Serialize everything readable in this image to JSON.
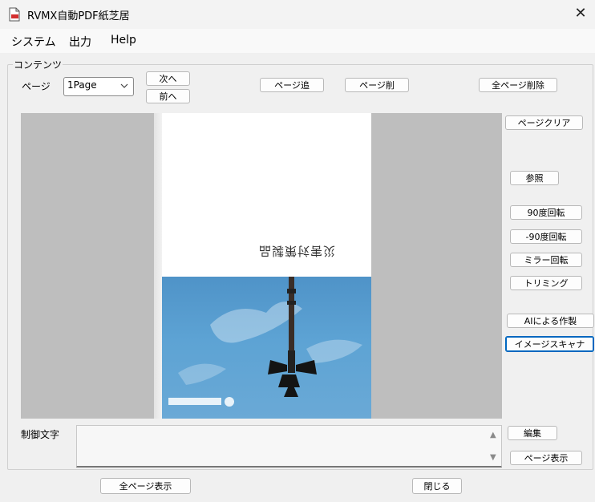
{
  "window": {
    "title": "RVMX自動PDF紙芝居",
    "close_glyph": "✕"
  },
  "menu": {
    "items": [
      "システム",
      "出力",
      "Help"
    ]
  },
  "contents": {
    "group_label": "コンテンツ",
    "page_label": "ページ",
    "page_select": {
      "value": "1Page"
    },
    "next_label": "次へ",
    "prev_label": "前へ",
    "page_add_label": "ページ追",
    "page_delete_label": "ページ削",
    "delete_all_label": "全ページ削除"
  },
  "side_buttons": {
    "page_clear": "ページクリア",
    "browse": "参照",
    "rotate_90": "90度回転",
    "rotate_minus_90": "-90度回転",
    "mirror_rotate": "ミラー回転",
    "trimming": "トリミング",
    "ai_create": "AIによる作製",
    "image_scanner": "イメージスキャナ"
  },
  "preview": {
    "page_title": "災害対策製品"
  },
  "control_text": {
    "label": "制御文字",
    "value": "",
    "edit_label": "編集",
    "page_display_label": "ページ表示"
  },
  "footer": {
    "show_all_label": "全ページ表示",
    "close_label": "閉じる"
  },
  "colors": {
    "viewer_bg": "#bebebe",
    "sky": "#5da3d4",
    "focus_border": "#0067c0"
  },
  "icons": {
    "app": "pdf-document-icon",
    "close": "close-icon",
    "dropdown": "chevron-down-icon",
    "scroll_up": "scroll-up-arrow-icon",
    "scroll_down": "scroll-down-arrow-icon"
  }
}
